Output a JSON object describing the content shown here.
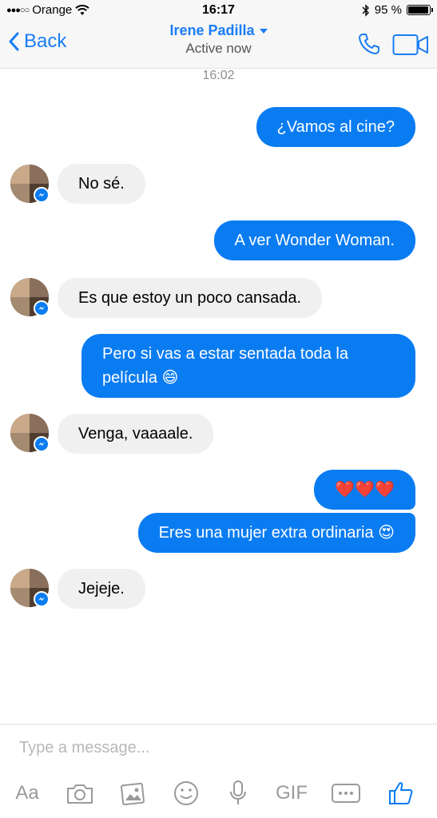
{
  "status_bar": {
    "signal": "●●●○○",
    "carrier": "Orange",
    "time": "16:17",
    "battery_text": "95 %",
    "battery_level": 0.95
  },
  "nav": {
    "back_label": "Back",
    "contact_name": "Irene Padilla",
    "contact_status": "Active now"
  },
  "conversation": {
    "timestamp": "16:02",
    "messages": [
      {
        "direction": "outgoing",
        "text": "¿Vamos al cine?"
      },
      {
        "direction": "incoming",
        "text": "No sé."
      },
      {
        "direction": "outgoing",
        "text": "A ver Wonder Woman."
      },
      {
        "direction": "incoming",
        "text": "Es que estoy un poco cansada."
      },
      {
        "direction": "outgoing",
        "text": "Pero si vas a estar sentada toda la película 😄"
      },
      {
        "direction": "incoming",
        "text": "Venga, vaaaale."
      },
      {
        "direction": "outgoing",
        "text": "❤️❤️❤️"
      },
      {
        "direction": "outgoing",
        "text": "Eres una mujer extra ordinaria 😍"
      },
      {
        "direction": "incoming",
        "text": "Jejeje."
      }
    ]
  },
  "composer": {
    "placeholder": "Type a message...",
    "toolbar": {
      "text_label": "Aa",
      "gif_label": "GIF"
    }
  },
  "colors": {
    "accent": "#0a7cf2",
    "incoming_bubble": "#f1f0f0",
    "icon_gray": "#9a9a9a"
  }
}
